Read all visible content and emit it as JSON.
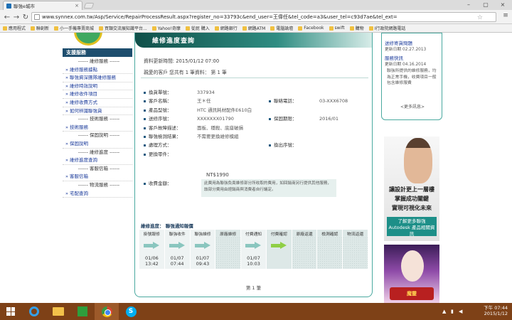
{
  "browser": {
    "tab_title": "聯強e城市",
    "url": "www.synnex.com.tw/Asp/Service/RepairProcessResult.aspx?register_no=33793c&end_user=王偉任&tel_code=a3&user_tel=c93d7ae&tel_ext=",
    "bookmarks": [
      "應用程式",
      "聯創新",
      "小一手機專賣商城",
      "買類交流展知識平台...",
      "Yahoo!奇摩",
      "從屁 購入",
      "網路銀行",
      "網路ATM",
      "電腦論壇",
      "Facebook",
      "swift",
      "購物",
      "Ⅰ行政院網路電話"
    ]
  },
  "sidebar": {
    "header": "支援服務",
    "items": [
      {
        "type": "sec",
        "label": "------ 維修服務 ------"
      },
      {
        "type": "link",
        "label": "維修服務據點"
      },
      {
        "type": "link",
        "label": "聯強資深團隊維修服務"
      },
      {
        "type": "link",
        "label": "維修時效說明"
      },
      {
        "type": "link",
        "label": "維修收件項目"
      },
      {
        "type": "link",
        "label": "維修收費方式"
      },
      {
        "type": "link",
        "label": "如何辨識聯強貨"
      },
      {
        "type": "sec",
        "label": "------ 技術服務 ------"
      },
      {
        "type": "link",
        "label": "技術服務"
      },
      {
        "type": "sec",
        "label": "------ 保固說明 ------"
      },
      {
        "type": "link",
        "label": "保固說明"
      },
      {
        "type": "sec",
        "label": "------ 維修進度 ------"
      },
      {
        "type": "link",
        "label": "維修進度查詢"
      },
      {
        "type": "sec",
        "label": "------ 客服信箱 ------"
      },
      {
        "type": "link",
        "label": "客服信箱"
      },
      {
        "type": "sec",
        "label": "------ 物流服務 ------"
      },
      {
        "type": "link",
        "label": "宅配查詢"
      }
    ]
  },
  "main": {
    "title": "維修進度查詢",
    "updated": "資料更新時間: 2015/01/12 07:00",
    "intro": "親愛的客戶 您共有 1 筆資料：   第 1 筆",
    "rows": [
      {
        "l1": "換貨單號：",
        "v1": "337934",
        "l2": "",
        "v2": ""
      },
      {
        "l1": "客戶名稱：",
        "v1": "王＊任",
        "l2": "聯絡電話：",
        "v2": "03-XXX6708"
      },
      {
        "l1": "產品型號：",
        "v1": "HTC 通訊耗材配件E610白",
        "l2": "",
        "v2": ""
      },
      {
        "l1": "送修序號：",
        "v1": "XXXXXXX01790",
        "l2": "保固期限：",
        "v2": "2016/01"
      },
      {
        "l1": "客戶故障描述：",
        "v1": "面板、穩殺、底座破損",
        "l2": "",
        "v2": ""
      },
      {
        "l1": "聯強檢測結果：",
        "v1": "不需要更換維修模組",
        "l2": "",
        "v2": ""
      },
      {
        "l1": "處理方式：",
        "v1": "",
        "l2": "換出序號：",
        "v2": ""
      },
      {
        "l1": "更換零件：",
        "v1": "",
        "l2": "",
        "v2": ""
      }
    ],
    "fee_label": "收費金額：",
    "fee_value": "NT$1990",
    "fee_note": "此費用為聯強負責維修部分所收取的費用，如回銷商另行提供其他服務，該部分費用由經銷商與消費者自行議定。",
    "progress_title": "維修進度： 聯強通知報價",
    "steps": [
      {
        "label": "掛號報修",
        "date": "01/06",
        "time": "13:42",
        "state": "done"
      },
      {
        "label": "聯強收件",
        "date": "01/07",
        "time": "07:44",
        "state": "done"
      },
      {
        "label": "聯強維修",
        "date": "01/07",
        "time": "09:43",
        "state": "done"
      },
      {
        "label": "原廠維修",
        "date": "",
        "time": "",
        "state": "none"
      },
      {
        "label": "付費通知",
        "date": "01/07",
        "time": "10:03",
        "state": "done"
      },
      {
        "label": "付費確認",
        "date": "",
        "time": "",
        "state": "cur"
      },
      {
        "label": "原廠返還",
        "date": "",
        "time": "",
        "state": "none"
      },
      {
        "label": "檢測確認",
        "date": "",
        "time": "",
        "state": "none"
      },
      {
        "label": "物流返還",
        "date": "",
        "time": "",
        "state": "none"
      }
    ],
    "pager": "第 1 筆"
  },
  "right": {
    "t1": "送修寄貨問題",
    "d1": "更新日期 02.27.2013",
    "t2": "服務快訊",
    "d2": "更新日期 04.16.2014",
    "text": "聯強所提供的維修服務，均為正常手機，收費項目一般包含維修服費",
    "more": "<更多訊息>",
    "ad_line1": "讓設計更上一層樓",
    "ad_line2": "掌握成功關鍵",
    "ad_line3": "實現可視化未來",
    "ad_btn": "了解更多聯強 Autodesk 產品相關資訊",
    "ad2_logo": "魔靈"
  },
  "taskbar": {
    "time": "下午 07:44",
    "date": "2015/1/12"
  }
}
